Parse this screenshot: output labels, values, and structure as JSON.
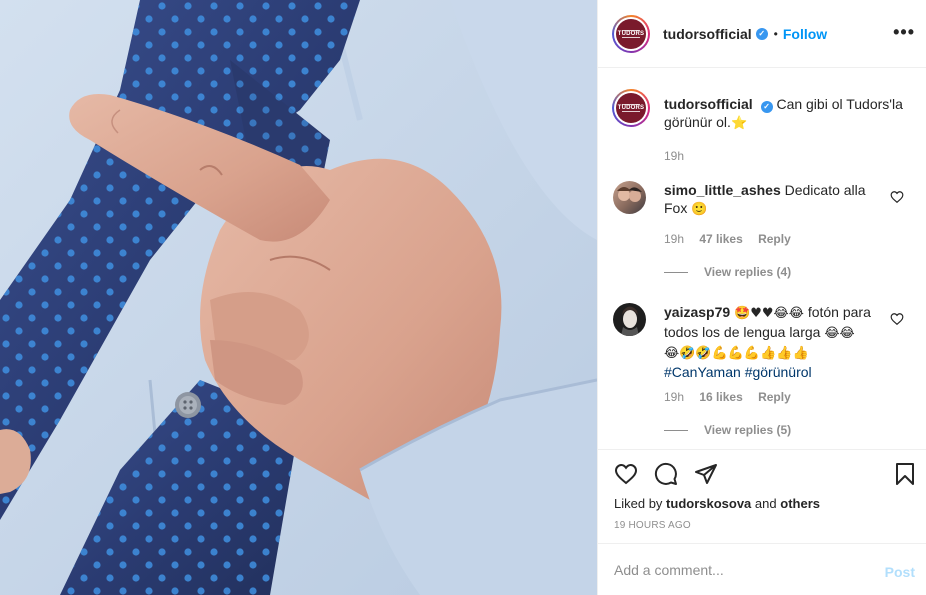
{
  "header": {
    "avatar_text": "TUDORS",
    "username": "tudorsofficial",
    "dot": "•",
    "follow_label": "Follow",
    "more_icon": "more-options-icon"
  },
  "caption": {
    "username": "tudorsofficial",
    "text": "Can gibi ol Tudors'la görünür ol.",
    "emoji": "⭐",
    "time": "19h"
  },
  "comments": [
    {
      "username": "simo_little_ashes",
      "text": "Dedicato alla Fox",
      "emoji": "🙂",
      "time": "19h",
      "likes": "47 likes",
      "reply": "Reply",
      "view_replies": "View replies (4)"
    },
    {
      "username": "yaizasp79",
      "emoji_prefix": "🤩♥♥😂😂",
      "text": "fotón para todos los de lengua larga",
      "emoji_line1": "😂😂",
      "emoji_line2": "😂🤣🤣💪💪💪👍👍👍",
      "hashtag1": "#CanYaman",
      "hashtag2": "#görünürol",
      "time": "19h",
      "likes": "16 likes",
      "reply": "Reply",
      "view_replies": "View replies (5)"
    }
  ],
  "actions": {
    "liked_prefix": "Liked by",
    "liked_user": "tudorskosova",
    "liked_and": "and",
    "liked_others": "others",
    "timestamp": "19 HOURS AGO"
  },
  "add_comment": {
    "placeholder": "Add a comment...",
    "post_label": "Post"
  },
  "colors": {
    "accent": "#0095f6",
    "brand": "#7a1a2c",
    "tie": "#2c3f7a",
    "shirt": "#c6d6ea"
  }
}
